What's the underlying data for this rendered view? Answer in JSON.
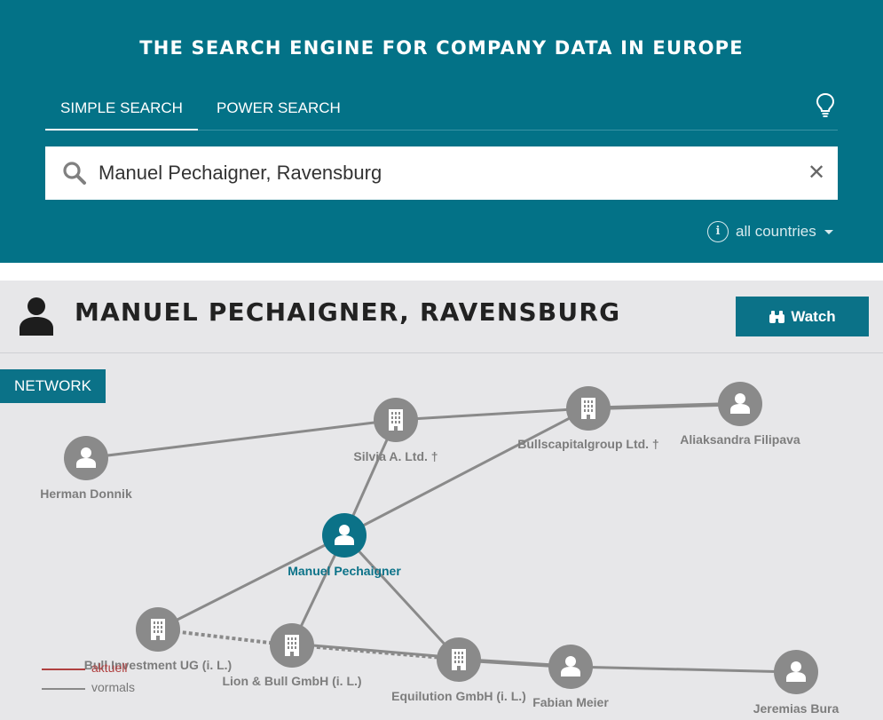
{
  "header": {
    "title": "THE SEARCH ENGINE FOR COMPANY DATA IN EUROPE",
    "tabs": [
      {
        "label": "SIMPLE SEARCH",
        "active": true
      },
      {
        "label": "POWER SEARCH",
        "active": false
      }
    ],
    "tip_icon": "lightbulb-icon"
  },
  "search": {
    "value": "Manuel Pechaigner, Ravensburg",
    "search_icon": "search-icon",
    "clear_icon": "close-icon",
    "country_filter": "all countries"
  },
  "profile": {
    "title": "MANUEL PECHAIGNER, RAVENSBURG",
    "icon": "person-icon",
    "watch_label": "Watch",
    "watch_icon": "binoculars-icon"
  },
  "network": {
    "tab_label": "NETWORK",
    "nodes": [
      {
        "id": "herman",
        "label": "Herman Donnik",
        "kind": "person"
      },
      {
        "id": "silvia",
        "label": "Silvia A. Ltd. †",
        "kind": "company"
      },
      {
        "id": "bulls",
        "label": "Bullscapitalgroup Ltd. †",
        "kind": "company"
      },
      {
        "id": "aliak",
        "label": "Aliaksandra Filipava",
        "kind": "person"
      },
      {
        "id": "manuel",
        "label": "Manuel Pechaigner",
        "kind": "person",
        "focus": true
      },
      {
        "id": "bullinv",
        "label": "Bull Investment UG (i. L.)",
        "kind": "company"
      },
      {
        "id": "lion",
        "label": "Lion & Bull GmbH (i. L.)",
        "kind": "company"
      },
      {
        "id": "equil",
        "label": "Equilution GmbH (i. L.)",
        "kind": "company"
      },
      {
        "id": "fabian",
        "label": "Fabian Meier",
        "kind": "person"
      },
      {
        "id": "jeremias",
        "label": "Jeremias Bura",
        "kind": "person"
      }
    ],
    "legend": [
      {
        "label": "aktuell",
        "color": "#b04040"
      },
      {
        "label": "vormals",
        "color": "#8a8a8a"
      }
    ]
  },
  "colors": {
    "brand": "#037287",
    "accent": "#0b7288",
    "node": "#8a8a8a"
  }
}
